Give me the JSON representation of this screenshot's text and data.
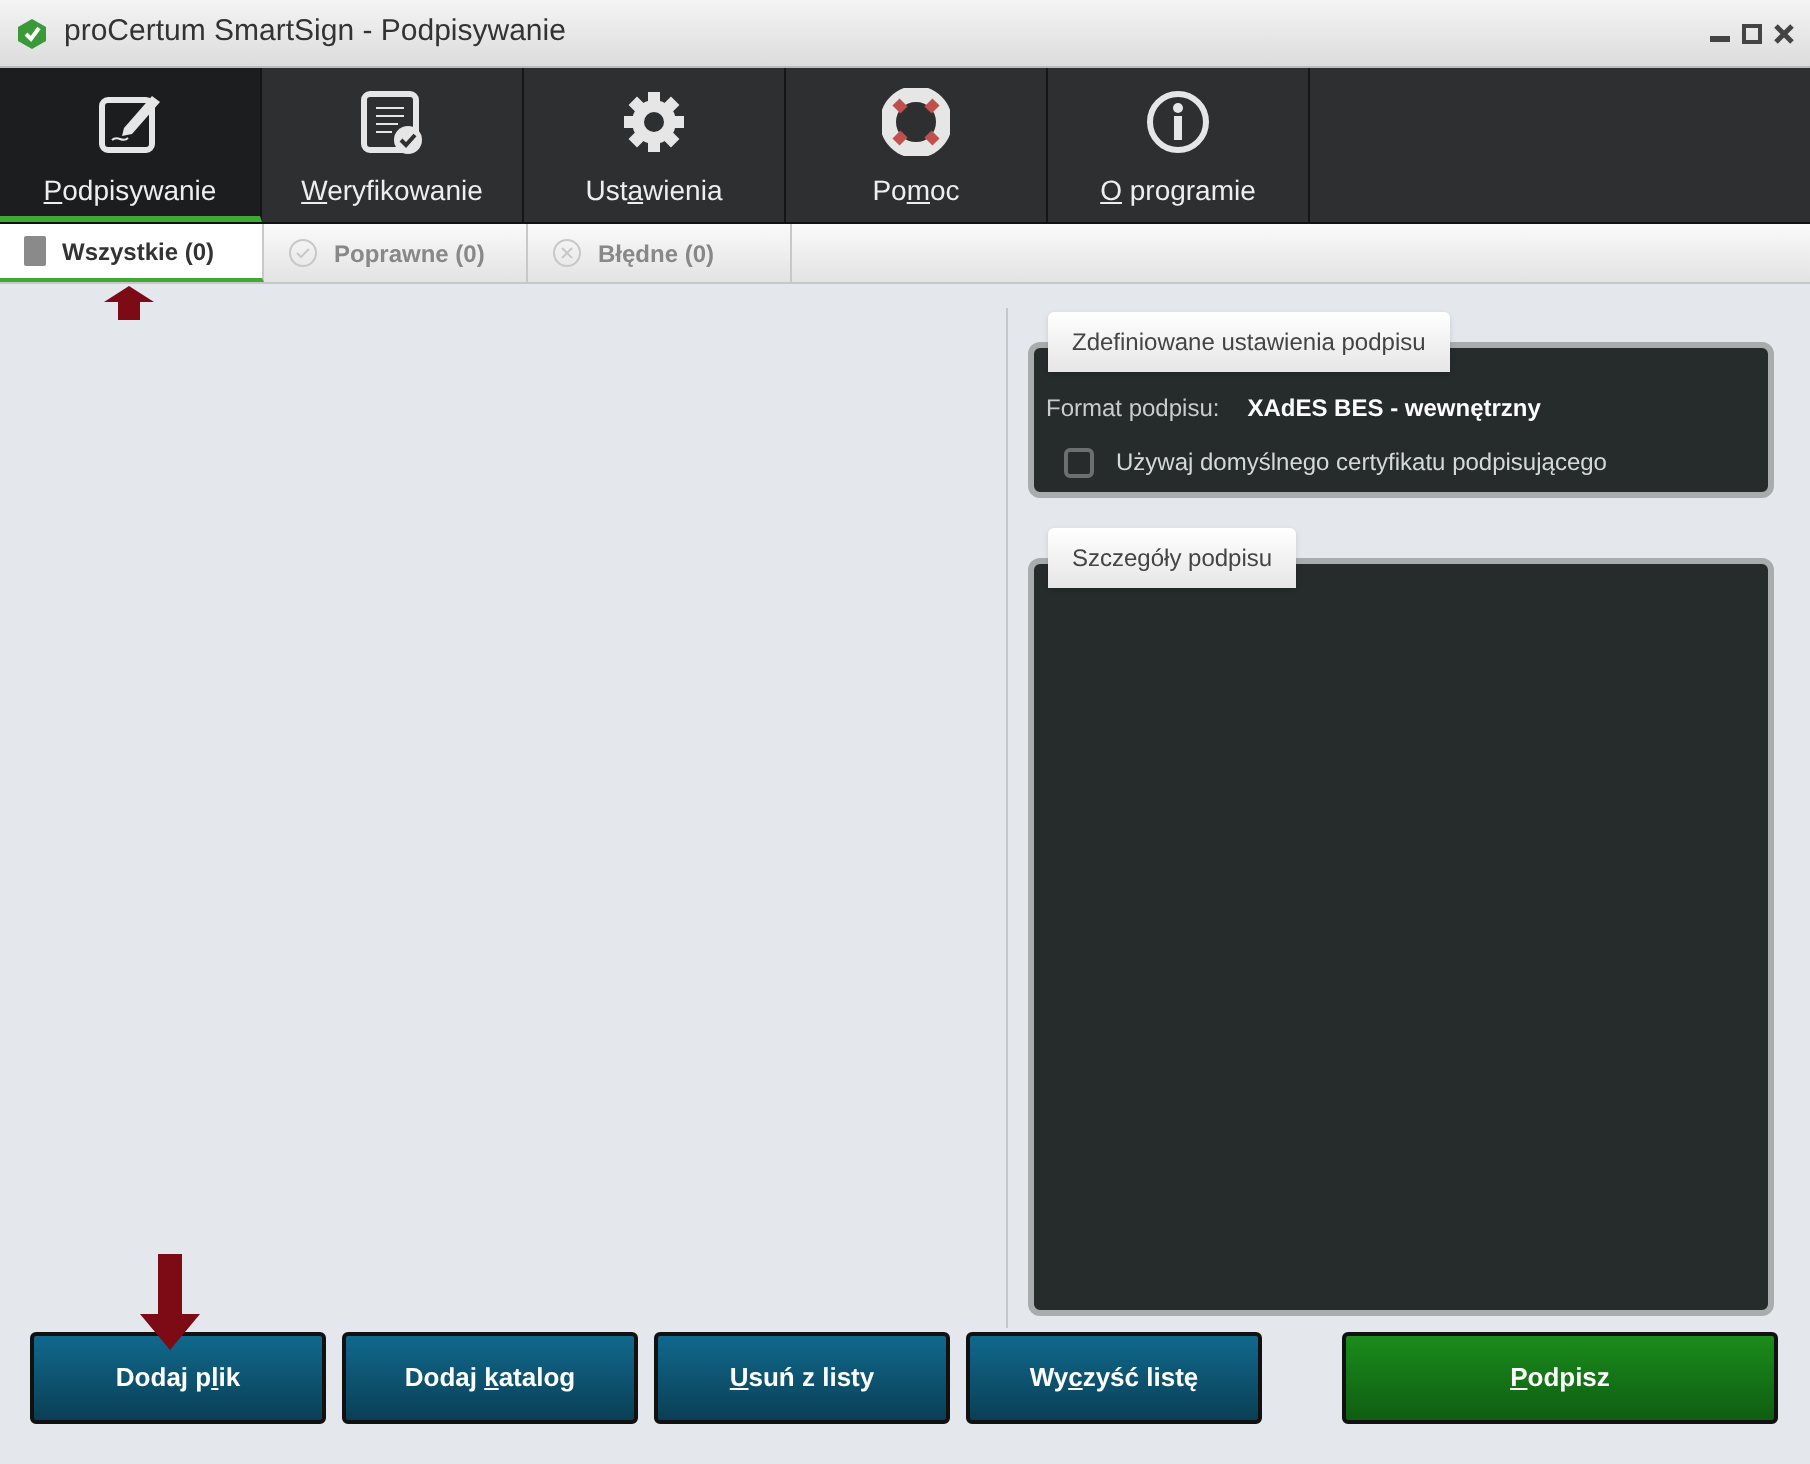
{
  "window": {
    "title": "proCertum SmartSign - Podpisywanie"
  },
  "nav": [
    {
      "kind": "sign",
      "key": "P",
      "post": "odpisywanie",
      "selected": true
    },
    {
      "kind": "verify",
      "key": "W",
      "post": "eryfikowanie",
      "selected": false
    },
    {
      "kind": "settings",
      "pre": "Ust",
      "key": "a",
      "post": "wienia",
      "selected": false
    },
    {
      "kind": "help",
      "pre": "Po",
      "key": "m",
      "post": "oc",
      "selected": false
    },
    {
      "kind": "about",
      "key": "O",
      "post": " programie",
      "selected": false
    }
  ],
  "tabs": [
    {
      "kind": "all",
      "label": "Wszystkie (0)",
      "selected": true
    },
    {
      "kind": "ok",
      "label": "Poprawne (0)",
      "selected": false
    },
    {
      "kind": "bad",
      "label": "Błędne (0)",
      "selected": false
    }
  ],
  "settings_panel": {
    "title": "Zdefiniowane ustawienia podpisu",
    "format_label": "Format podpisu:",
    "format_value": "XAdES BES - wewnętrzny",
    "checkbox": {
      "label": "Używaj domyślnego certyfikatu podpisującego",
      "checked": false
    }
  },
  "details_panel": {
    "title": "Szczegóły podpisu"
  },
  "buttons": [
    {
      "kind": "action",
      "pre": "Dodaj p",
      "key": "l",
      "post": "ik"
    },
    {
      "kind": "action",
      "pre": "Dodaj ",
      "key": "k",
      "post": "atalog"
    },
    {
      "kind": "action",
      "key": "U",
      "post": "suń z listy"
    },
    {
      "kind": "action",
      "pre": "Wy",
      "key": "c",
      "post": "zyść listę"
    },
    {
      "kind": "primary",
      "key": "P",
      "post": "odpisz"
    }
  ]
}
